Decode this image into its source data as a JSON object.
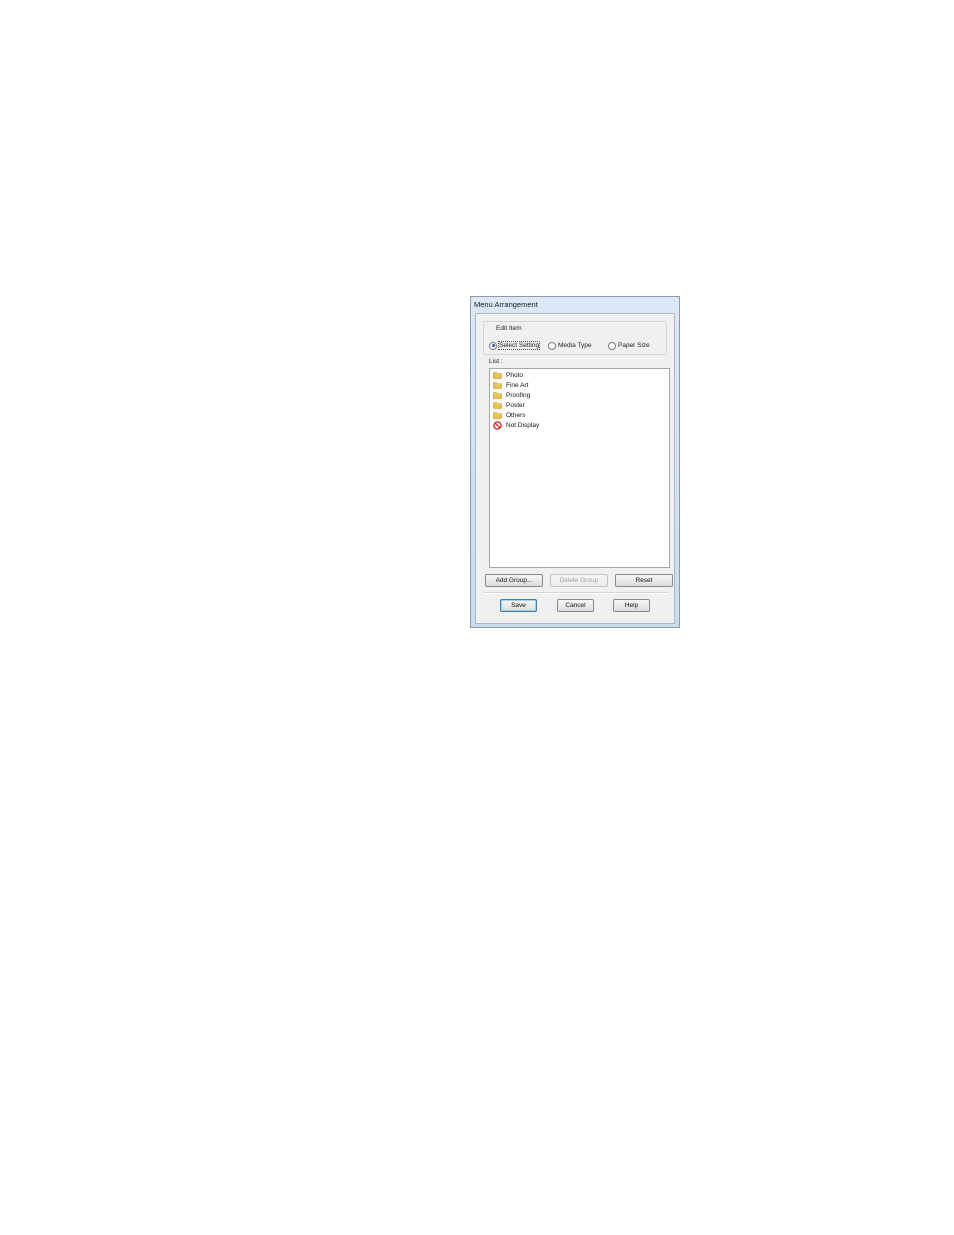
{
  "dialog": {
    "title": "Menu Arrangement",
    "edit_item": {
      "label": "Edit Item",
      "options": [
        {
          "label": "Select Setting",
          "checked": true
        },
        {
          "label": "Media Type",
          "checked": false
        },
        {
          "label": "Paper Size",
          "checked": false
        }
      ]
    },
    "list": {
      "label": "List :",
      "items": [
        {
          "label": "Photo",
          "icon": "folder-icon"
        },
        {
          "label": "Fine Art",
          "icon": "folder-icon"
        },
        {
          "label": "Proofing",
          "icon": "folder-icon"
        },
        {
          "label": "Poster",
          "icon": "folder-icon"
        },
        {
          "label": "Others",
          "icon": "folder-icon"
        },
        {
          "label": "Not Display",
          "icon": "not-display-icon"
        }
      ]
    },
    "buttons": {
      "add_group": "Add Group...",
      "delete_group": "Delete Group",
      "reset": "Reset",
      "save": "Save",
      "cancel": "Cancel",
      "help": "Help"
    },
    "colors": {
      "folder": "#e8c04a",
      "not_display": "#d32f2f",
      "default_button_border": "#3c7fb1"
    }
  }
}
